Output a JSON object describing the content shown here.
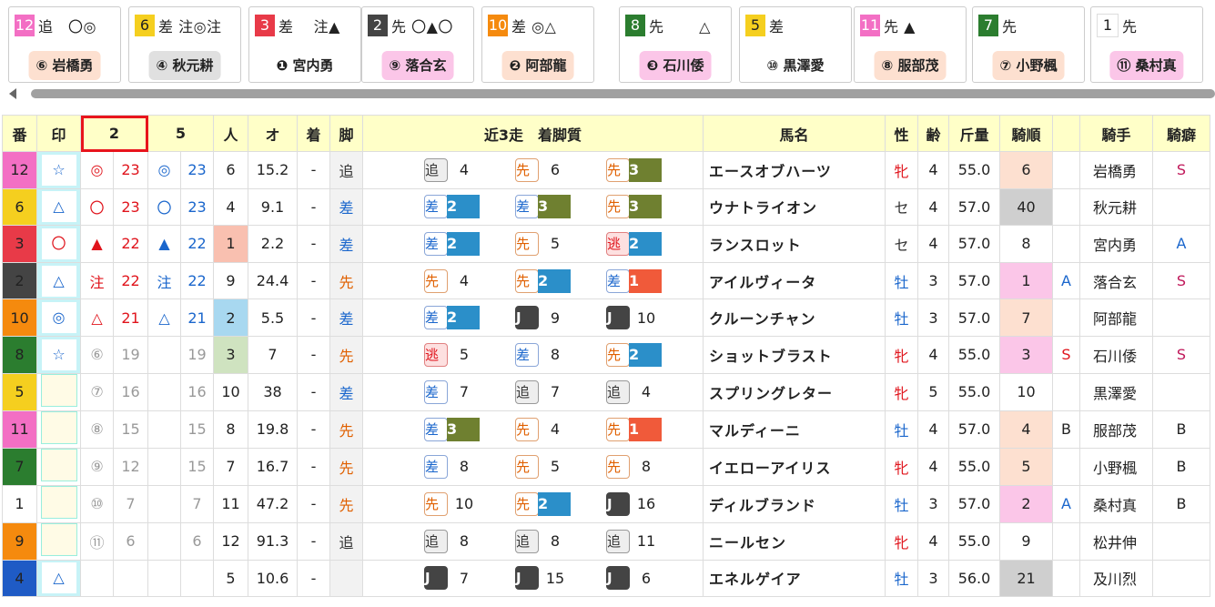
{
  "colors": {
    "waku": [
      "#ffffff",
      "#ffffff",
      "#444444",
      "#e83a48",
      "#1f5bc5",
      "#f5cf1f",
      "#2b7d2f",
      "#f58a0e",
      "#f36fc4"
    ],
    "header_bg": "#ffffc8",
    "highlight_border": "#e8141c"
  },
  "cards": [
    {
      "num": "12",
      "waku": "pink",
      "marks": "追　〇◎",
      "jockey": "⑥ 岩橋勇",
      "jbg": "#fde0d0"
    },
    {
      "num": "6",
      "waku": "yellow",
      "marks": "差 注◎注",
      "jockey": "④ 秋元耕",
      "jbg": "#e0e0e0"
    },
    {
      "num": "3",
      "waku": "red",
      "marks": "差　 注▲",
      "jockey": "❶ 宮内勇",
      "jbg": "#ffffff"
    },
    {
      "num": "2",
      "waku": "dark",
      "marks": "先 〇▲〇",
      "jockey": "⑨ 落合玄",
      "jbg": "#fbc6e8"
    },
    {
      "num": "10",
      "waku": "orange",
      "marks": "差 ◎△",
      "jockey": "❷ 阿部龍",
      "jbg": "#fde0d0"
    },
    {
      "num": "8",
      "waku": "green",
      "marks": "先　　 △",
      "jockey": "❸ 石川倭",
      "jbg": "#fbc6e8"
    },
    {
      "num": "5",
      "waku": "yellow",
      "marks": "差",
      "jockey": "⑩ 黒澤愛",
      "jbg": "#ffffff"
    },
    {
      "num": "11",
      "waku": "pink",
      "marks": "先 ▲",
      "jockey": "⑧ 服部茂",
      "jbg": "#fde0d0"
    },
    {
      "num": "7",
      "waku": "green",
      "marks": "先",
      "jockey": "⑦ 小野楓",
      "jbg": "#fde0d0"
    },
    {
      "num": "1",
      "waku": "white",
      "marks": "先",
      "jockey": "⑪ 桑村真",
      "jbg": "#fbc6e8"
    }
  ],
  "headers": {
    "ban": "番",
    "in": "印",
    "c2": "2",
    "c5": "5",
    "ninki": "人",
    "odds": "オ",
    "chaku": "着",
    "ashi": "脚",
    "past": "近3走　着脚質",
    "name": "馬名",
    "sex": "性",
    "age": "齢",
    "kin": "斤量",
    "kijun": "騎順",
    "jockey": "騎手",
    "kiheki": "騎癖"
  },
  "rows": [
    {
      "ban": "12",
      "waku": "pink",
      "mark": "☆",
      "m2": "◎",
      "v2": "23",
      "m5": "◎",
      "v5": "23",
      "ninki": "6",
      "odds": "15.2",
      "chaku": "-",
      "ashi": "追",
      "past": [
        [
          "追",
          "4",
          ""
        ],
        [
          "先",
          "6",
          ""
        ],
        [
          "先",
          "3",
          "p3"
        ]
      ],
      "name": "エースオブハーツ",
      "sex": "牝",
      "age": "4",
      "kin": "55.0",
      "kijun": "6",
      "kflag": "",
      "jockey": "岩橋勇",
      "kiheki": "S"
    },
    {
      "ban": "6",
      "waku": "yellow",
      "mark": "△",
      "m2": "〇",
      "v2": "23",
      "m5": "〇",
      "v5": "23",
      "ninki": "4",
      "odds": "9.1",
      "chaku": "-",
      "ashi": "差",
      "past": [
        [
          "差",
          "2",
          "p2"
        ],
        [
          "差",
          "3",
          "p3"
        ],
        [
          "先",
          "3",
          "p3"
        ]
      ],
      "name": "ウナトライオン",
      "sex": "セ",
      "age": "4",
      "kin": "57.0",
      "kijun": "40",
      "kflag": "",
      "jockey": "秋元耕",
      "kiheki": ""
    },
    {
      "ban": "3",
      "waku": "red",
      "mark": "〇",
      "m2": "▲",
      "v2": "22",
      "m5": "▲",
      "v5": "22",
      "ninki": "1",
      "odds": "2.2",
      "chaku": "-",
      "ashi": "差",
      "past": [
        [
          "差",
          "2",
          "p2"
        ],
        [
          "先",
          "5",
          ""
        ],
        [
          "逃",
          "2",
          "p2"
        ]
      ],
      "name": "ランスロット",
      "sex": "セ",
      "age": "4",
      "kin": "57.0",
      "kijun": "8",
      "kflag": "",
      "jockey": "宮内勇",
      "kiheki": "A"
    },
    {
      "ban": "2",
      "waku": "dark",
      "mark": "△",
      "m2": "注",
      "v2": "22",
      "m5": "注",
      "v5": "22",
      "ninki": "9",
      "odds": "24.4",
      "chaku": "-",
      "ashi": "先",
      "past": [
        [
          "先",
          "4",
          ""
        ],
        [
          "先",
          "2",
          "p2"
        ],
        [
          "差",
          "1",
          "p1"
        ]
      ],
      "name": "アイルヴィータ",
      "sex": "牡",
      "age": "3",
      "kin": "57.0",
      "kijun": "1",
      "kflag": "A",
      "jockey": "落合玄",
      "kiheki": "S"
    },
    {
      "ban": "10",
      "waku": "orange",
      "mark": "◎",
      "m2": "△",
      "v2": "21",
      "m5": "△",
      "v5": "21",
      "ninki": "2",
      "odds": "5.5",
      "chaku": "-",
      "ashi": "差",
      "past": [
        [
          "差",
          "2",
          "p2"
        ],
        [
          "J",
          "9",
          ""
        ],
        [
          "J",
          "10",
          ""
        ]
      ],
      "name": "クルーンチャン",
      "sex": "牡",
      "age": "3",
      "kin": "57.0",
      "kijun": "7",
      "kflag": "",
      "jockey": "阿部龍",
      "kiheki": ""
    },
    {
      "ban": "8",
      "waku": "green",
      "mark": "☆",
      "m2": "⑥",
      "v2": "19",
      "m5": "",
      "v5": "19",
      "ninki": "3",
      "odds": "7",
      "chaku": "-",
      "ashi": "先",
      "past": [
        [
          "逃",
          "5",
          ""
        ],
        [
          "差",
          "8",
          ""
        ],
        [
          "先",
          "2",
          "p2"
        ]
      ],
      "name": "ショットブラスト",
      "sex": "牝",
      "age": "4",
      "kin": "55.0",
      "kijun": "3",
      "kflag": "S",
      "jockey": "石川倭",
      "kiheki": "S"
    },
    {
      "ban": "5",
      "waku": "yellow",
      "mark": "",
      "m2": "⑦",
      "v2": "16",
      "m5": "",
      "v5": "16",
      "ninki": "10",
      "odds": "38",
      "chaku": "-",
      "ashi": "差",
      "past": [
        [
          "差",
          "7",
          ""
        ],
        [
          "追",
          "7",
          ""
        ],
        [
          "追",
          "4",
          ""
        ]
      ],
      "name": "スプリングレター",
      "sex": "牝",
      "age": "5",
      "kin": "55.0",
      "kijun": "10",
      "kflag": "",
      "jockey": "黒澤愛",
      "kiheki": ""
    },
    {
      "ban": "11",
      "waku": "pink",
      "mark": "",
      "m2": "⑧",
      "v2": "15",
      "m5": "",
      "v5": "15",
      "ninki": "8",
      "odds": "19.8",
      "chaku": "-",
      "ashi": "先",
      "past": [
        [
          "差",
          "3",
          "p3"
        ],
        [
          "先",
          "4",
          ""
        ],
        [
          "先",
          "1",
          "p1"
        ]
      ],
      "name": "マルディーニ",
      "sex": "牡",
      "age": "4",
      "kin": "57.0",
      "kijun": "4",
      "kflag": "B",
      "jockey": "服部茂",
      "kiheki": "B"
    },
    {
      "ban": "7",
      "waku": "green",
      "mark": "",
      "m2": "⑨",
      "v2": "12",
      "m5": "",
      "v5": "15",
      "ninki": "7",
      "odds": "16.7",
      "chaku": "-",
      "ashi": "先",
      "past": [
        [
          "差",
          "8",
          ""
        ],
        [
          "先",
          "5",
          ""
        ],
        [
          "先",
          "8",
          ""
        ]
      ],
      "name": "イエローアイリス",
      "sex": "牝",
      "age": "4",
      "kin": "55.0",
      "kijun": "5",
      "kflag": "",
      "jockey": "小野楓",
      "kiheki": "B"
    },
    {
      "ban": "1",
      "waku": "white",
      "mark": "",
      "m2": "⑩",
      "v2": "7",
      "m5": "",
      "v5": "7",
      "ninki": "11",
      "odds": "47.2",
      "chaku": "-",
      "ashi": "先",
      "past": [
        [
          "先",
          "10",
          ""
        ],
        [
          "先",
          "2",
          "p2"
        ],
        [
          "J",
          "16",
          ""
        ]
      ],
      "name": "ディルブランド",
      "sex": "牡",
      "age": "3",
      "kin": "57.0",
      "kijun": "2",
      "kflag": "A",
      "jockey": "桑村真",
      "kiheki": "B"
    },
    {
      "ban": "9",
      "waku": "orange",
      "mark": "",
      "m2": "⑪",
      "v2": "6",
      "m5": "",
      "v5": "6",
      "ninki": "12",
      "odds": "91.3",
      "chaku": "-",
      "ashi": "追",
      "past": [
        [
          "追",
          "8",
          ""
        ],
        [
          "追",
          "8",
          ""
        ],
        [
          "追",
          "11",
          ""
        ]
      ],
      "name": "ニールセン",
      "sex": "牝",
      "age": "4",
      "kin": "55.0",
      "kijun": "9",
      "kflag": "",
      "jockey": "松井伸",
      "kiheki": ""
    },
    {
      "ban": "4",
      "waku": "blue",
      "mark": "△",
      "m2": "",
      "v2": "",
      "m5": "",
      "v5": "",
      "ninki": "5",
      "odds": "10.6",
      "chaku": "-",
      "ashi": "",
      "past": [
        [
          "J",
          "7",
          ""
        ],
        [
          "J",
          "15",
          ""
        ],
        [
          "J",
          "6",
          ""
        ]
      ],
      "name": "エネルゲイア",
      "sex": "牡",
      "age": "3",
      "kin": "56.0",
      "kijun": "21",
      "kflag": "",
      "jockey": "及川烈",
      "kiheki": ""
    }
  ]
}
